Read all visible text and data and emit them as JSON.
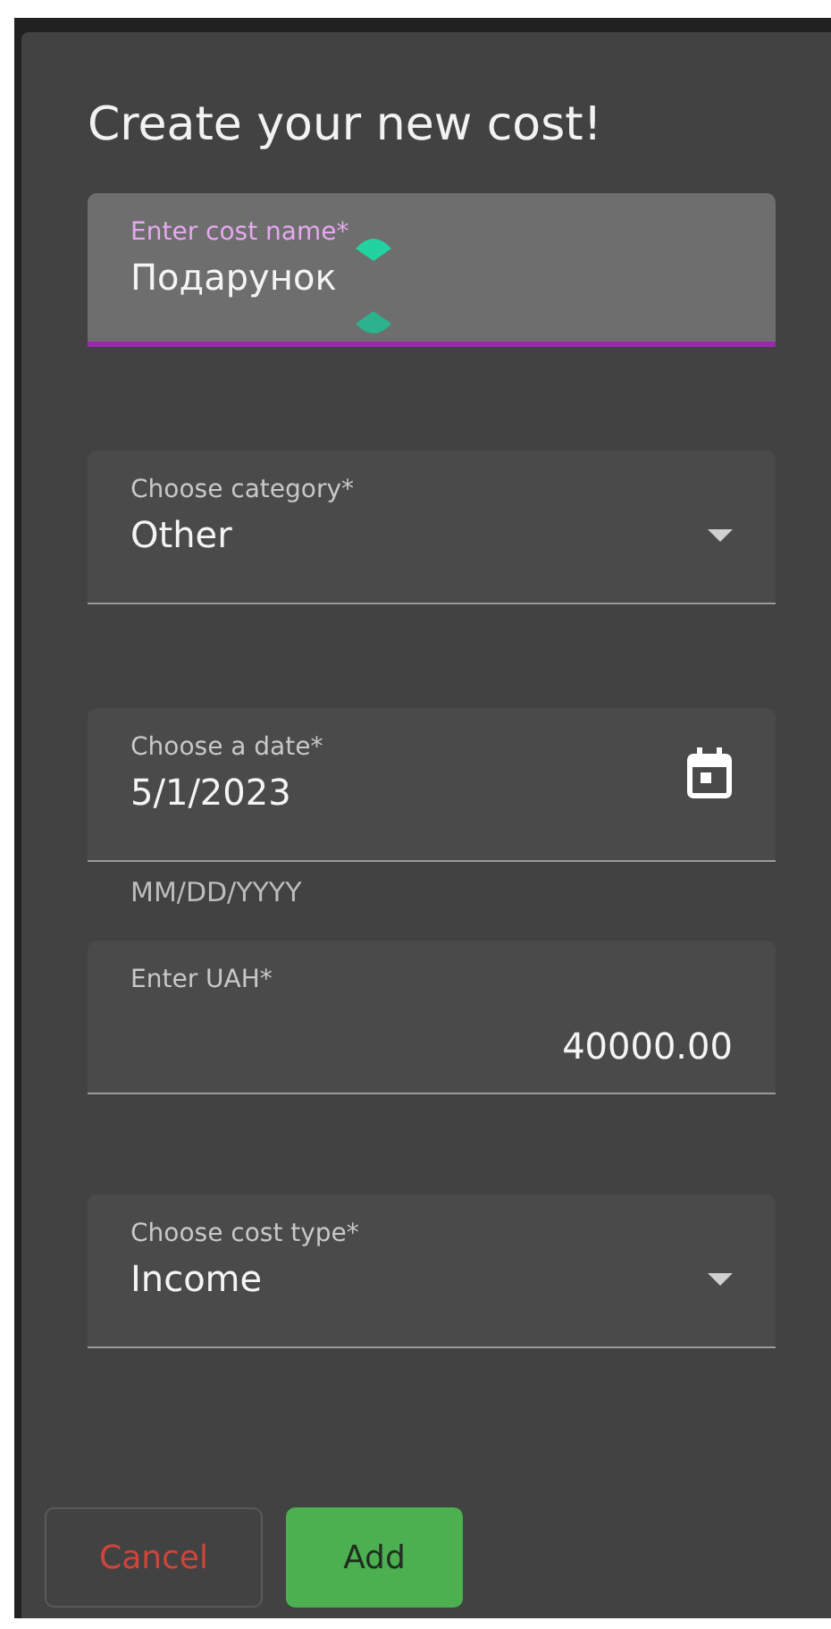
{
  "dialog": {
    "title": "Create your new cost!"
  },
  "fields": [
    {
      "kind": "text",
      "label": "Enter cost name*",
      "value": "Подарунок",
      "focused": true
    },
    {
      "kind": "select",
      "label": "Choose category*",
      "value": "Other",
      "focused": false
    },
    {
      "kind": "date",
      "label": "Choose a date*",
      "value": "5/1/2023",
      "helper": "MM/DD/YYYY",
      "focused": false
    },
    {
      "kind": "number",
      "label": "Enter UAH*",
      "value": "40000.00",
      "focused": false
    },
    {
      "kind": "select",
      "label": "Choose cost type*",
      "value": "Income",
      "focused": false
    }
  ],
  "buttons": [
    {
      "kind": "outlined",
      "label": "Cancel"
    },
    {
      "kind": "filled",
      "label": "Add"
    }
  ]
}
